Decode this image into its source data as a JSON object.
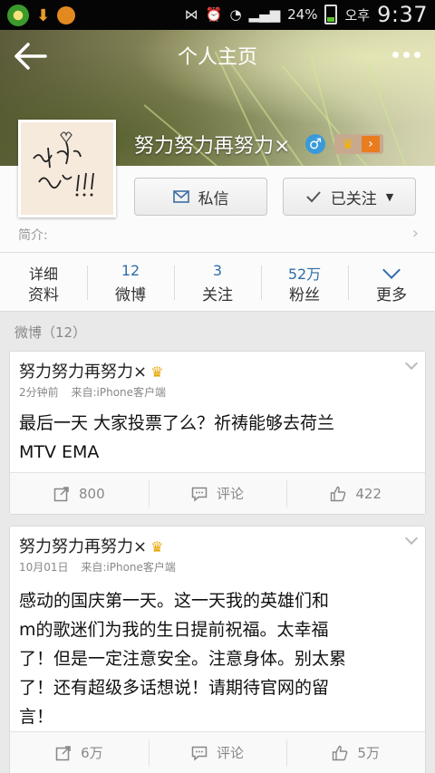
{
  "status_bar": {
    "battery": "24%",
    "carrier": "오후",
    "time": "9:37"
  },
  "header": {
    "title": "个人主页"
  },
  "profile": {
    "name": "努力努力再努力×",
    "gender": "♂",
    "bio_label": "简介:",
    "message_button": "私信",
    "follow_button": "已关注",
    "stats": [
      {
        "num": "",
        "label_top": "详细",
        "label": "资料"
      },
      {
        "num": "12",
        "label": "微博"
      },
      {
        "num": "3",
        "label": "关注"
      },
      {
        "num": "52万",
        "label": "粉丝"
      },
      {
        "num": "",
        "label": "更多"
      }
    ]
  },
  "section": {
    "label": "微博（12）"
  },
  "posts": [
    {
      "author": "努力努力再努力×",
      "time": "2分钟前",
      "source": "来自:iPhone客户端",
      "text_lines": [
        "最后一天 大家投票了么？祈祷能够去荷兰",
        "MTV EMA"
      ],
      "reposts": "800",
      "comments": "评论",
      "likes": "422"
    },
    {
      "author": "努力努力再努力×",
      "time": "10月01日",
      "source": "来自:iPhone客户端",
      "text_lines": [
        "感动的国庆第一天。这一天我的英雄们和",
        "m的歌迷们为我的生日提前祝福。太幸福",
        "了！但是一定注意安全。注意身体。别太累",
        "了！还有超级多话想说！请期待官网的留",
        "言！"
      ],
      "reposts": "6万",
      "comments": "评论",
      "likes": "5万"
    }
  ]
}
